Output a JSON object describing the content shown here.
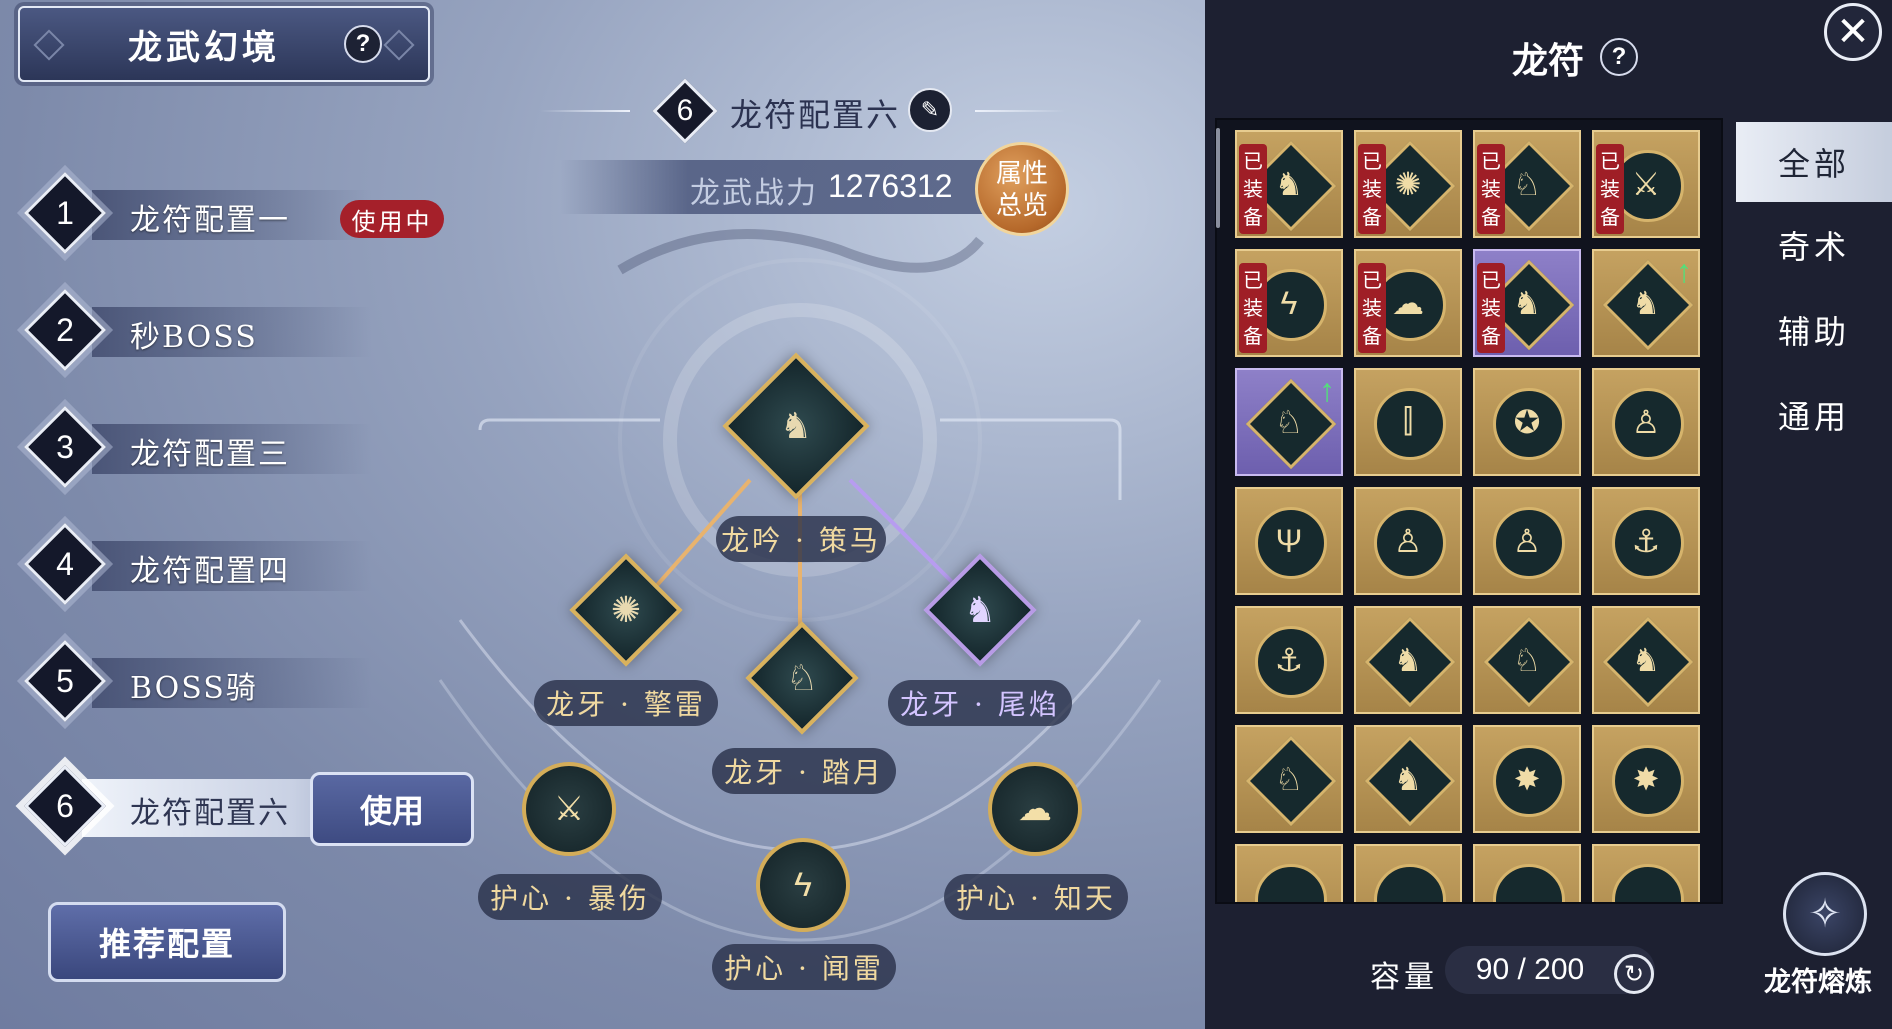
{
  "title": {
    "text": "龙武幻境",
    "help": "?"
  },
  "configs": [
    {
      "num": "1",
      "name": "龙符配置一"
    },
    {
      "num": "2",
      "name": "秒BOSS"
    },
    {
      "num": "3",
      "name": "龙符配置三"
    },
    {
      "num": "4",
      "name": "龙符配置四"
    },
    {
      "num": "5",
      "name": "BOSS骑"
    },
    {
      "num": "6",
      "name": "龙符配置六"
    }
  ],
  "in_use_badge": "使用中",
  "use_button": "使用",
  "recommend_button": "推荐配置",
  "current": {
    "num": "6",
    "name": "龙符配置六"
  },
  "power": {
    "label": "龙武战力",
    "value": "1276312"
  },
  "attr_button": {
    "line1": "属性",
    "line2": "总览"
  },
  "tree": {
    "top": "龙吟 · 策马",
    "left": "龙牙 · 擎雷",
    "mid": "龙牙 · 踏月",
    "right": "龙牙 · 尾焰",
    "guard_left": "护心 · 暴伤",
    "guard_mid": "护心 · 闻雷",
    "guard_right": "护心 · 知天"
  },
  "panel": {
    "title": "龙符",
    "help": "?",
    "close": "✕"
  },
  "equipped_tag": "已装备",
  "tabs": [
    "全部",
    "奇术",
    "辅助",
    "通用"
  ],
  "active_tab": "全部",
  "capacity": {
    "label": "容量",
    "value": "90 / 200"
  },
  "forge": {
    "label": "龙符熔炼"
  },
  "icons": [
    "help-icon",
    "edit-icon",
    "close-icon",
    "refresh-icon",
    "forge-icon",
    "dragon-emblem"
  ],
  "colors": {
    "accent_gold": "#d9b25d",
    "badge_red": "#a5202a",
    "panel_bg": "#1d2031",
    "purple_rarity": "#8e80c8"
  }
}
